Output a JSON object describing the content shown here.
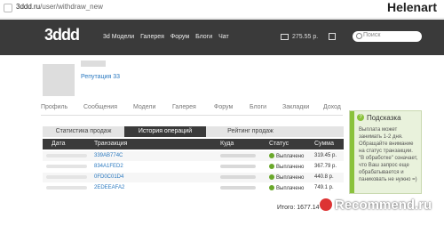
{
  "browser": {
    "url_domain": "3ddd.ru",
    "url_path": "/user/withdraw_new"
  },
  "top_right_user": "Helenart",
  "header": {
    "logo": "3ddd",
    "nav": [
      "3d Модели",
      "Галерея",
      "Форум",
      "Блоги",
      "Чат"
    ],
    "balance": "275.55 р.",
    "search_placeholder": "Поиск"
  },
  "profile": {
    "reputation": "Репутация 33"
  },
  "profile_tabs": [
    "Профиль",
    "Сообщения",
    "Модели",
    "Галерея",
    "Форум",
    "Блоги",
    "Закладки",
    "Доход"
  ],
  "operation_tabs": [
    "Статистика продаж",
    "История операций",
    "Рейтинг продаж"
  ],
  "table": {
    "headers": [
      "Дата",
      "Транзакция",
      "Куда",
      "Статус",
      "Сумма"
    ],
    "rows": [
      {
        "tx": "339AB774C",
        "status": "Выплачено",
        "sum": "319.45 р."
      },
      {
        "tx": "834A1FED2",
        "status": "Выплачено",
        "sum": "367.79 р."
      },
      {
        "tx": "0FD0C01D4",
        "status": "Выплачено",
        "sum": "440.8 р."
      },
      {
        "tx": "2EDEEAFA2",
        "status": "Выплачено",
        "sum": "749.1 р."
      }
    ],
    "total": "Итого: 1677.14"
  },
  "hint": {
    "title": "Подсказка",
    "text": "Выплата может занимать 1-2 дня. Обращайте внимание на статус транзакции. \"В обработке\" означает, что Ваш запрос еще обрабатывается и паниковать не нужно =)"
  },
  "watermark": "Recommend.ru",
  "colors": {
    "header_bg": "#3a3a3a",
    "link": "#2a79c0",
    "status_ok": "#6aa82b",
    "hint_bg": "#e9f2dc"
  }
}
